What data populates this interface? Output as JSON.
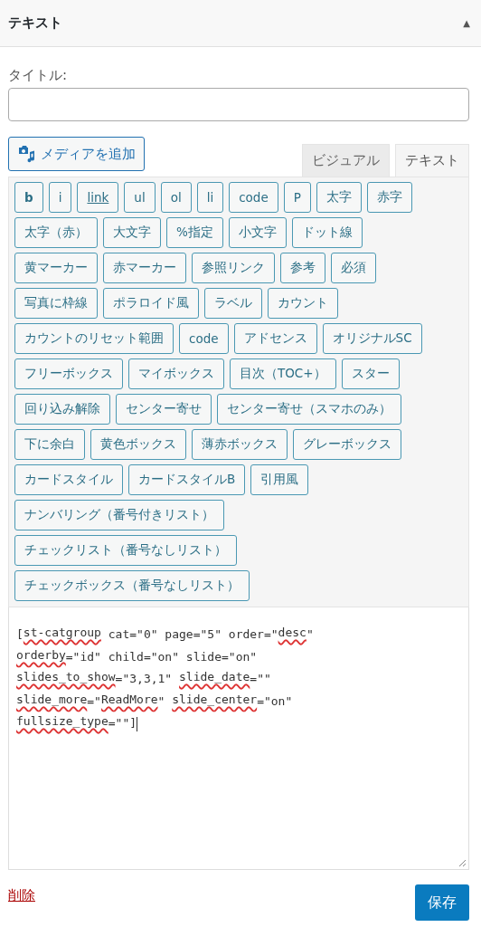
{
  "panel": {
    "title": "テキスト",
    "collapse_icon": "▲"
  },
  "title_field": {
    "label": "タイトル:"
  },
  "media_button": {
    "label": "メディアを追加"
  },
  "tabs": [
    {
      "label": "ビジュアル",
      "selected": false
    },
    {
      "label": "テキスト",
      "selected": true
    }
  ],
  "quicktag_rows": [
    [
      {
        "label": "b",
        "kind": "bold"
      },
      {
        "label": "i"
      },
      {
        "label": "link",
        "kind": "link"
      },
      {
        "label": "ul"
      },
      {
        "label": "ol"
      },
      {
        "label": "li"
      },
      {
        "label": "code"
      },
      {
        "label": "P"
      },
      {
        "label": "太字"
      },
      {
        "label": "赤字"
      }
    ],
    [
      {
        "label": "太字（赤）"
      },
      {
        "label": "大文字"
      },
      {
        "label": "%指定"
      },
      {
        "label": "小文字"
      },
      {
        "label": "ドット線"
      }
    ],
    [
      {
        "label": "黄マーカー"
      },
      {
        "label": "赤マーカー"
      },
      {
        "label": "参照リンク"
      },
      {
        "label": "参考"
      },
      {
        "label": "必須"
      }
    ],
    [
      {
        "label": "写真に枠線"
      },
      {
        "label": "ポラロイド風"
      },
      {
        "label": "ラベル"
      },
      {
        "label": "カウント"
      }
    ],
    [
      {
        "label": "カウントのリセット範囲"
      },
      {
        "label": "code"
      },
      {
        "label": "アドセンス"
      },
      {
        "label": "オリジナルSC"
      }
    ],
    [
      {
        "label": "フリーボックス"
      },
      {
        "label": "マイボックス"
      },
      {
        "label": "目次（TOC+）"
      },
      {
        "label": "スター"
      }
    ],
    [
      {
        "label": "回り込み解除"
      },
      {
        "label": "センター寄せ"
      },
      {
        "label": "センター寄せ（スマホのみ）"
      }
    ],
    [
      {
        "label": "下に余白"
      },
      {
        "label": "黄色ボックス"
      },
      {
        "label": "薄赤ボックス"
      },
      {
        "label": "グレーボックス"
      }
    ],
    [
      {
        "label": "カードスタイル"
      },
      {
        "label": "カードスタイルB"
      },
      {
        "label": "引用風"
      }
    ],
    [
      {
        "label": "ナンバリング（番号付きリスト）"
      }
    ],
    [
      {
        "label": "チェックリスト（番号なしリスト）"
      }
    ],
    [
      {
        "label": "チェックボックス（番号なしリスト）"
      }
    ]
  ],
  "editor_lines": [
    [
      {
        "text": "["
      },
      {
        "text": "st-catgroup",
        "misspelled": true
      },
      {
        "text": " cat=\"0\" page=\"5\" order=\""
      },
      {
        "text": "desc",
        "misspelled": true
      },
      {
        "text": "\""
      }
    ],
    [
      {
        "text": "orderby",
        "misspelled": true
      },
      {
        "text": "=\"id\" child=\"on\" slide=\"on\""
      }
    ],
    [
      {
        "text": "slides_to_show",
        "misspelled": true
      },
      {
        "text": "=\"3,3,1\" "
      },
      {
        "text": "slide_date",
        "misspelled": true
      },
      {
        "text": "=\"\""
      }
    ],
    [
      {
        "text": "slide_more",
        "misspelled": true
      },
      {
        "text": "=\""
      },
      {
        "text": "ReadMore",
        "misspelled": true
      },
      {
        "text": "\" "
      },
      {
        "text": "slide_center",
        "misspelled": true
      },
      {
        "text": "=\"on\""
      }
    ],
    [
      {
        "text": "fullsize_type",
        "misspelled": true
      },
      {
        "text": "=\"\"]"
      }
    ]
  ],
  "delete_link": "削除",
  "save_button": "保存"
}
